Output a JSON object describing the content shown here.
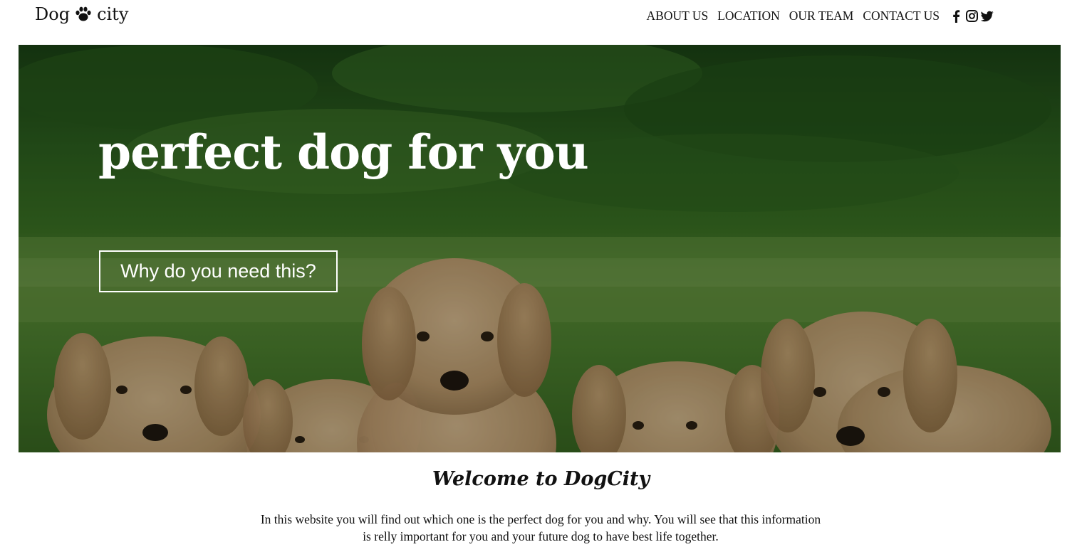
{
  "brand": {
    "text_left": "Dog",
    "icon": "paw-icon",
    "text_right": "city"
  },
  "nav": {
    "items": [
      {
        "label": "ABOUT US"
      },
      {
        "label": "LOCATION"
      },
      {
        "label": "OUR TEAM"
      },
      {
        "label": "CONTACT US"
      }
    ],
    "social_icons": [
      "facebook-icon",
      "instagram-icon",
      "twitter-icon"
    ]
  },
  "hero": {
    "title": "perfect dog for you",
    "button_label": "Why do you need this?"
  },
  "welcome": {
    "title": "Welcome to DogCity",
    "text": "In this website you will find out which one is the perfect dog for you and why. You will see that this information is relly important for you and your future dog to have best life together."
  },
  "colors": {
    "text": "#111111",
    "hero_text": "#ffffff",
    "grass": "#4d7f2a",
    "puppy": "#c9a77c"
  }
}
